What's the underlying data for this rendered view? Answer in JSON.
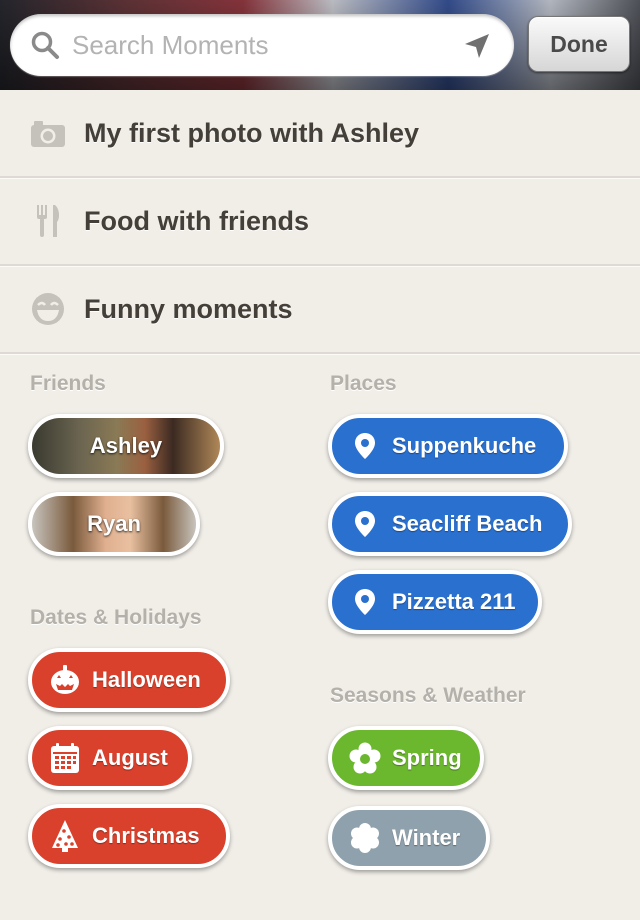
{
  "search": {
    "placeholder": "Search Moments",
    "done_label": "Done"
  },
  "moments": [
    {
      "label": "My first photo with Ashley",
      "icon": "camera-icon"
    },
    {
      "label": "Food with friends",
      "icon": "fork-knife-icon"
    },
    {
      "label": "Funny moments",
      "icon": "laughing-face-icon"
    }
  ],
  "sections": {
    "friends": {
      "title": "Friends",
      "items": [
        "Ashley",
        "Ryan"
      ]
    },
    "places": {
      "title": "Places",
      "items": [
        "Suppenkuche",
        "Seacliff Beach",
        "Pizzetta 211"
      ]
    },
    "dates": {
      "title": "Dates & Holidays",
      "items": [
        "Halloween",
        "August",
        "Christmas"
      ]
    },
    "seasons": {
      "title": "Seasons & Weather",
      "items": [
        "Spring",
        "Winter"
      ]
    }
  },
  "colors": {
    "place": "#2a70cf",
    "date": "#d9412c",
    "spring": "#6bb72e",
    "winter": "#8fa1ac",
    "background": "#f1eee8"
  },
  "icons": {
    "place": "map-pin-icon",
    "halloween": "pumpkin-icon",
    "august": "calendar-icon",
    "christmas": "christmas-tree-icon",
    "spring": "flower-icon",
    "winter": "snowflake-icon"
  }
}
